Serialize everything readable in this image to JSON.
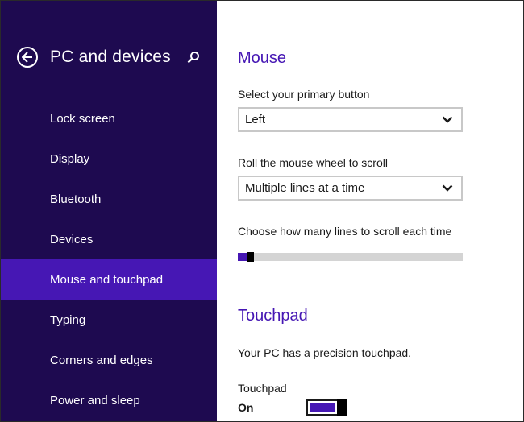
{
  "sidebar": {
    "title": "PC and devices",
    "back_icon": "back-arrow-icon",
    "search_icon": "search-icon",
    "background": "#1e0a50",
    "selected_color": "#4617b4",
    "items": [
      {
        "label": "Lock screen",
        "selected": false
      },
      {
        "label": "Display",
        "selected": false
      },
      {
        "label": "Bluetooth",
        "selected": false
      },
      {
        "label": "Devices",
        "selected": false
      },
      {
        "label": "Mouse and touchpad",
        "selected": true
      },
      {
        "label": "Typing",
        "selected": false
      },
      {
        "label": "Corners and edges",
        "selected": false
      },
      {
        "label": "Power and sleep",
        "selected": false
      }
    ]
  },
  "mouse": {
    "title": "Mouse",
    "primary_button_label": "Select your primary button",
    "primary_button_value": "Left",
    "scroll_label": "Roll the mouse wheel to scroll",
    "scroll_value": "Multiple lines at a time",
    "lines_label": "Choose how many lines to scroll each time",
    "lines_slider_fraction": 0.04
  },
  "touchpad": {
    "title": "Touchpad",
    "description": "Your PC has a precision touchpad.",
    "toggle_label": "Touchpad",
    "toggle_state": "On",
    "toggle_on": true
  },
  "colors": {
    "accent": "#4617b4",
    "sidebar_bg": "#1e0a50"
  }
}
